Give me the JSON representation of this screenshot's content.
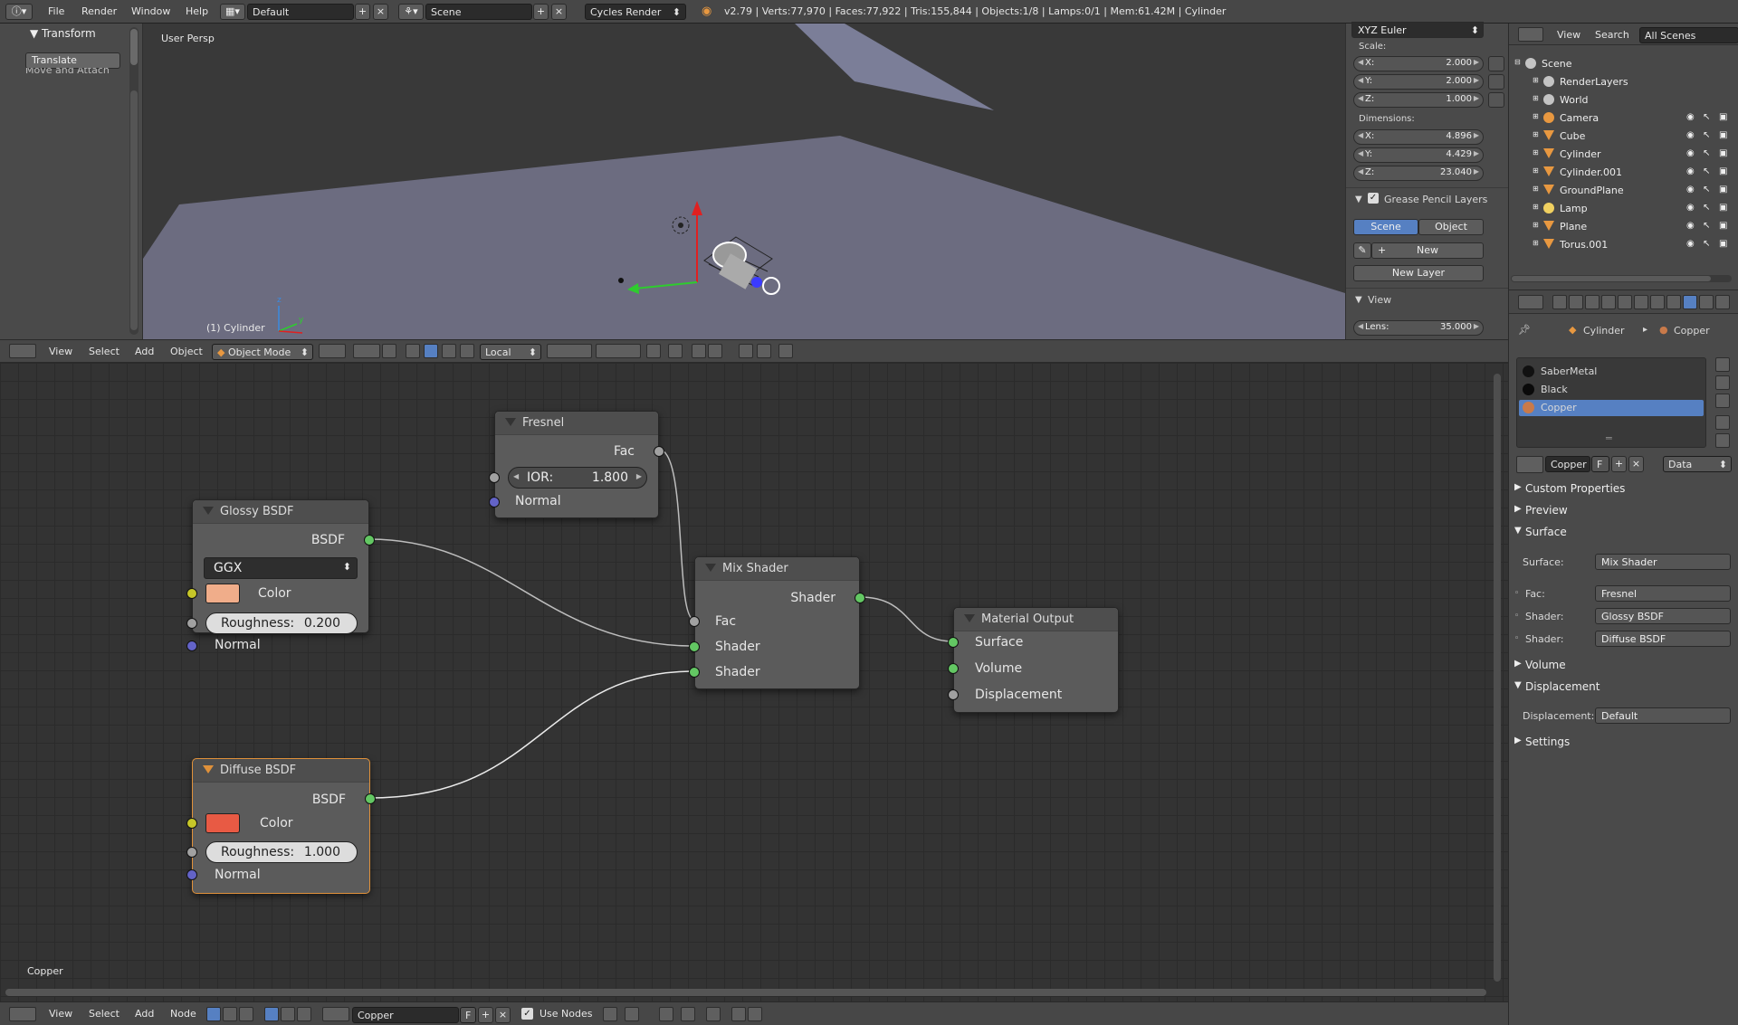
{
  "topbar": {
    "menus": [
      "File",
      "Render",
      "Window",
      "Help"
    ],
    "layout": "Default",
    "scene": "Scene",
    "engine": "Cycles Render",
    "stats": "v2.79 | Verts:77,970 | Faces:77,922 | Tris:155,844 | Objects:1/8 | Lamps:0/1 | Mem:61.42M | Cylinder"
  },
  "toolshelf": {
    "panel_title": "Transform",
    "button": "Translate",
    "cut_text": "Move and Attach"
  },
  "viewport": {
    "view_name": "User Persp",
    "object_label": "(1) Cylinder"
  },
  "npanel": {
    "rotation_mode": "XYZ Euler",
    "scale_label": "Scale:",
    "scale": [
      {
        "k": "X:",
        "v": "2.000"
      },
      {
        "k": "Y:",
        "v": "2.000"
      },
      {
        "k": "Z:",
        "v": "1.000"
      }
    ],
    "dimensions_label": "Dimensions:",
    "dimensions": [
      {
        "k": "X:",
        "v": "4.896"
      },
      {
        "k": "Y:",
        "v": "4.429"
      },
      {
        "k": "Z:",
        "v": "23.040"
      }
    ],
    "grease_title": "Grease Pencil Layers",
    "tab_scene": "Scene",
    "tab_object": "Object",
    "new_btn": "New",
    "new_layer_btn": "New Layer",
    "view_title": "View",
    "lens_label": "Lens:",
    "lens_value": "35.000"
  },
  "v3dheader": {
    "menus": [
      "View",
      "Select",
      "Add",
      "Object"
    ],
    "mode": "Object Mode",
    "orientation": "Local"
  },
  "nodes": {
    "fresnel": {
      "title": "Fresnel",
      "out": "Fac",
      "ior_label": "IOR:",
      "ior_value": "1.800",
      "normal": "Normal"
    },
    "glossy": {
      "title": "Glossy BSDF",
      "out": "BSDF",
      "dist": "GGX",
      "color": "Color",
      "rough_label": "Roughness:",
      "rough_value": "0.200",
      "normal": "Normal",
      "swatch": "#f0ad8a"
    },
    "mix": {
      "title": "Mix Shader",
      "out": "Shader",
      "fac": "Fac",
      "in1": "Shader",
      "in2": "Shader"
    },
    "output": {
      "title": "Material Output",
      "surface": "Surface",
      "volume": "Volume",
      "displacement": "Displacement"
    },
    "diffuse": {
      "title": "Diffuse BSDF",
      "out": "BSDF",
      "color": "Color",
      "rough_label": "Roughness:",
      "rough_value": "1.000",
      "normal": "Normal",
      "swatch": "#e85a44"
    }
  },
  "node_editor_label": "Copper",
  "outliner": {
    "menus": [
      "View",
      "Search"
    ],
    "filter": "All Scenes",
    "items": [
      {
        "name": "Scene",
        "icon": "scene-icon"
      },
      {
        "name": "RenderLayers",
        "icon": "renderlayers-icon"
      },
      {
        "name": "World",
        "icon": "world-icon"
      },
      {
        "name": "Camera",
        "icon": "camera-icon"
      },
      {
        "name": "Cube",
        "icon": "mesh-icon"
      },
      {
        "name": "Cylinder",
        "icon": "mesh-icon"
      },
      {
        "name": "Cylinder.001",
        "icon": "mesh-icon"
      },
      {
        "name": "GroundPlane",
        "icon": "mesh-icon"
      },
      {
        "name": "Lamp",
        "icon": "lamp-icon"
      },
      {
        "name": "Plane",
        "icon": "mesh-icon"
      },
      {
        "name": "Torus.001",
        "icon": "mesh-icon"
      }
    ]
  },
  "props": {
    "breadcrumb_object": "Cylinder",
    "breadcrumb_material": "Copper",
    "materials": [
      "SaberMetal",
      "Black",
      "Copper"
    ],
    "material_name": "Copper",
    "f_label": "F",
    "data_dropdown": "Data",
    "panels": {
      "custom": "Custom Properties",
      "preview": "Preview",
      "surface": "Surface",
      "volume": "Volume",
      "displacement": "Displacement",
      "settings": "Settings"
    },
    "surface_label": "Surface:",
    "surface_value": "Mix Shader",
    "fac_label": "Fac:",
    "fac_value": "Fresnel",
    "shader1_label": "Shader:",
    "shader1_value": "Glossy BSDF",
    "shader2_label": "Shader:",
    "shader2_value": "Diffuse BSDF",
    "disp_label": "Displacement:",
    "disp_value": "Default"
  },
  "nodeheader": {
    "menus": [
      "View",
      "Select",
      "Add",
      "Node"
    ],
    "material": "Copper",
    "f_label": "F",
    "use_nodes": "Use Nodes"
  },
  "colors": {
    "accent": "#5680c2",
    "selected_outline": "#e0913a"
  }
}
